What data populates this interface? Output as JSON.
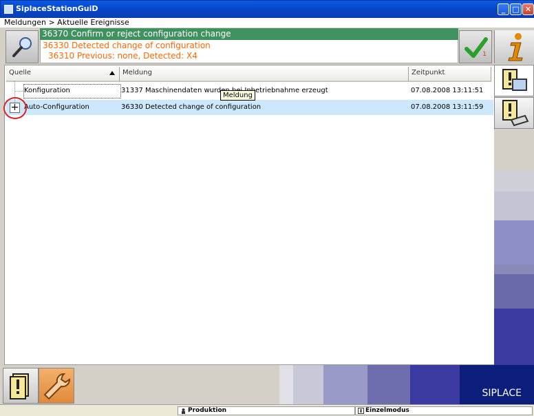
{
  "window": {
    "title": "SiplaceStationGuiD"
  },
  "breadcrumb": {
    "text": "Meldungen > Aktuelle Ereignisse"
  },
  "header": {
    "top_message": "36370 Confirm or reject configuration change",
    "line1": "36330 Detected change of configuration",
    "line2": "36310 Previous: none, Detected: X4",
    "ack_count": "1"
  },
  "table": {
    "columns": [
      "Quelle",
      "Meldung",
      "Zeitpunkt"
    ],
    "rows": [
      {
        "source": "Konfiguration",
        "message": "31337 Maschinendaten wurden bei Inbetriebnahme erzeugt",
        "time": "07.08.2008 13:11:51"
      },
      {
        "source": "Auto-Configuration",
        "message": "36330 Detected change of configuration",
        "time": "07.08.2008 13:11:59"
      }
    ],
    "tooltip": "Meldung"
  },
  "brand": {
    "label": "SIPLACE"
  },
  "statusbar": {
    "mode1": "Produktion",
    "mode2": "Einzelmodus"
  },
  "colors": {
    "accent_green": "#3f9160",
    "warning_orange": "#ff6600",
    "selected_row": "#cde8fd",
    "brand_blue": "#0b1f7a"
  }
}
